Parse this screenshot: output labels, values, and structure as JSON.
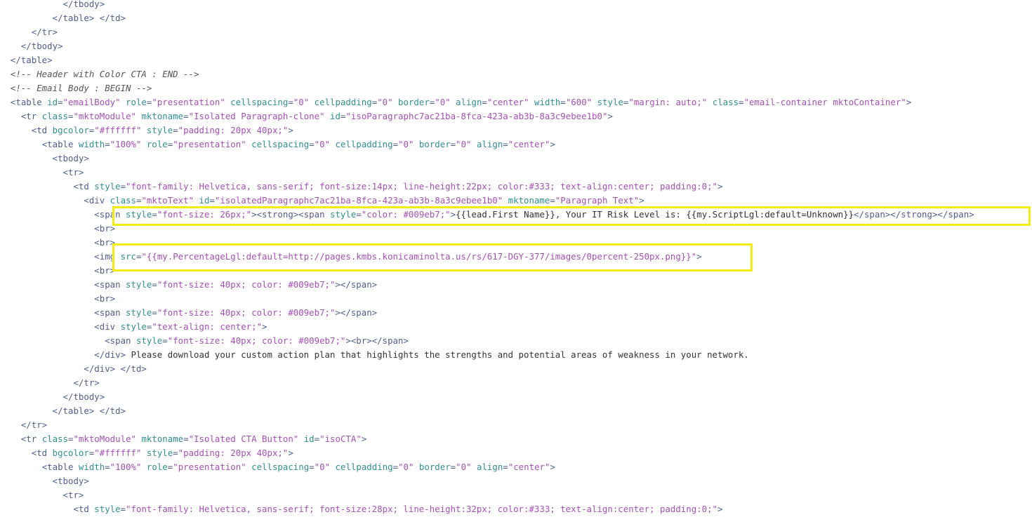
{
  "code_lines": [
    [
      {
        "t": "text",
        "v": "            "
      },
      {
        "t": "tag",
        "v": "</tbody>"
      }
    ],
    [
      {
        "t": "text",
        "v": "          "
      },
      {
        "t": "tag",
        "v": "</table>"
      },
      {
        "t": "text",
        "v": " "
      },
      {
        "t": "tag",
        "v": "</td>"
      }
    ],
    [
      {
        "t": "text",
        "v": "      "
      },
      {
        "t": "tag",
        "v": "</tr>"
      }
    ],
    [
      {
        "t": "text",
        "v": "    "
      },
      {
        "t": "tag",
        "v": "</tbody>"
      }
    ],
    [
      {
        "t": "text",
        "v": "  "
      },
      {
        "t": "tag",
        "v": "</table>"
      }
    ],
    [
      {
        "t": "text",
        "v": "  "
      },
      {
        "t": "comment",
        "v": "<!-- Header with Color CTA : END -->"
      }
    ],
    [
      {
        "t": "text",
        "v": "  "
      },
      {
        "t": "comment",
        "v": "<!-- Email Body : BEGIN -->"
      }
    ],
    [
      {
        "t": "text",
        "v": "  "
      },
      {
        "t": "tag",
        "v": "<table "
      },
      {
        "t": "attr",
        "v": "id"
      },
      {
        "t": "tag",
        "v": "="
      },
      {
        "t": "val",
        "v": "\"emailBody\""
      },
      {
        "t": "attr",
        "v": " role"
      },
      {
        "t": "tag",
        "v": "="
      },
      {
        "t": "val",
        "v": "\"presentation\""
      },
      {
        "t": "attr",
        "v": " cellspacing"
      },
      {
        "t": "tag",
        "v": "="
      },
      {
        "t": "val",
        "v": "\"0\""
      },
      {
        "t": "attr",
        "v": " cellpadding"
      },
      {
        "t": "tag",
        "v": "="
      },
      {
        "t": "val",
        "v": "\"0\""
      },
      {
        "t": "attr",
        "v": " border"
      },
      {
        "t": "tag",
        "v": "="
      },
      {
        "t": "val",
        "v": "\"0\""
      },
      {
        "t": "attr",
        "v": " align"
      },
      {
        "t": "tag",
        "v": "="
      },
      {
        "t": "val",
        "v": "\"center\""
      },
      {
        "t": "attr",
        "v": " width"
      },
      {
        "t": "tag",
        "v": "="
      },
      {
        "t": "val",
        "v": "\"600\""
      },
      {
        "t": "attr",
        "v": " style"
      },
      {
        "t": "tag",
        "v": "="
      },
      {
        "t": "val",
        "v": "\"margin: auto;\""
      },
      {
        "t": "attr",
        "v": " class"
      },
      {
        "t": "tag",
        "v": "="
      },
      {
        "t": "val",
        "v": "\"email-container mktoContainer\""
      },
      {
        "t": "tag",
        "v": ">"
      }
    ],
    [
      {
        "t": "text",
        "v": "    "
      },
      {
        "t": "tag",
        "v": "<tr "
      },
      {
        "t": "attr",
        "v": "class"
      },
      {
        "t": "tag",
        "v": "="
      },
      {
        "t": "val",
        "v": "\"mktoModule\""
      },
      {
        "t": "attr",
        "v": " mktoname"
      },
      {
        "t": "tag",
        "v": "="
      },
      {
        "t": "val",
        "v": "\"Isolated Paragraph-clone\""
      },
      {
        "t": "attr",
        "v": " id"
      },
      {
        "t": "tag",
        "v": "="
      },
      {
        "t": "val",
        "v": "\"isoParagraphc7ac21ba-8fca-423a-ab3b-8a3c9ebee1b0\""
      },
      {
        "t": "tag",
        "v": ">"
      }
    ],
    [
      {
        "t": "text",
        "v": "      "
      },
      {
        "t": "tag",
        "v": "<td "
      },
      {
        "t": "attr",
        "v": "bgcolor"
      },
      {
        "t": "tag",
        "v": "="
      },
      {
        "t": "val",
        "v": "\"#ffffff\""
      },
      {
        "t": "attr",
        "v": " style"
      },
      {
        "t": "tag",
        "v": "="
      },
      {
        "t": "val",
        "v": "\"padding: 20px 40px;\""
      },
      {
        "t": "tag",
        "v": ">"
      }
    ],
    [
      {
        "t": "text",
        "v": "        "
      },
      {
        "t": "tag",
        "v": "<table "
      },
      {
        "t": "attr",
        "v": "width"
      },
      {
        "t": "tag",
        "v": "="
      },
      {
        "t": "val",
        "v": "\"100%\""
      },
      {
        "t": "attr",
        "v": " role"
      },
      {
        "t": "tag",
        "v": "="
      },
      {
        "t": "val",
        "v": "\"presentation\""
      },
      {
        "t": "attr",
        "v": " cellspacing"
      },
      {
        "t": "tag",
        "v": "="
      },
      {
        "t": "val",
        "v": "\"0\""
      },
      {
        "t": "attr",
        "v": " cellpadding"
      },
      {
        "t": "tag",
        "v": "="
      },
      {
        "t": "val",
        "v": "\"0\""
      },
      {
        "t": "attr",
        "v": " border"
      },
      {
        "t": "tag",
        "v": "="
      },
      {
        "t": "val",
        "v": "\"0\""
      },
      {
        "t": "attr",
        "v": " align"
      },
      {
        "t": "tag",
        "v": "="
      },
      {
        "t": "val",
        "v": "\"center\""
      },
      {
        "t": "tag",
        "v": ">"
      }
    ],
    [
      {
        "t": "text",
        "v": "          "
      },
      {
        "t": "tag",
        "v": "<tbody>"
      }
    ],
    [
      {
        "t": "text",
        "v": "            "
      },
      {
        "t": "tag",
        "v": "<tr>"
      }
    ],
    [
      {
        "t": "text",
        "v": "              "
      },
      {
        "t": "tag",
        "v": "<td "
      },
      {
        "t": "attr",
        "v": "style"
      },
      {
        "t": "tag",
        "v": "="
      },
      {
        "t": "val",
        "v": "\"font-family: Helvetica, sans-serif; font-size:14px; line-height:22px; color:#333; text-align:center; padding:0;\""
      },
      {
        "t": "tag",
        "v": ">"
      }
    ],
    [
      {
        "t": "text",
        "v": "                "
      },
      {
        "t": "tag",
        "v": "<div "
      },
      {
        "t": "attr",
        "v": "class"
      },
      {
        "t": "tag",
        "v": "="
      },
      {
        "t": "val",
        "v": "\"mktoText\""
      },
      {
        "t": "attr",
        "v": " id"
      },
      {
        "t": "tag",
        "v": "="
      },
      {
        "t": "val",
        "v": "\"isolatedParagraphc7ac21ba-8fca-423a-ab3b-8a3c9ebee1b0\""
      },
      {
        "t": "attr",
        "v": " mktoname"
      },
      {
        "t": "tag",
        "v": "="
      },
      {
        "t": "val",
        "v": "\"Paragraph Text\""
      },
      {
        "t": "tag",
        "v": ">"
      }
    ],
    [
      {
        "t": "text",
        "v": "                  "
      },
      {
        "t": "tag",
        "v": "<span "
      },
      {
        "t": "attr",
        "v": "style"
      },
      {
        "t": "tag",
        "v": "="
      },
      {
        "t": "val",
        "v": "\"font-size: 26px;\""
      },
      {
        "t": "tag",
        "v": "><strong><span "
      },
      {
        "t": "attr",
        "v": "style"
      },
      {
        "t": "tag",
        "v": "="
      },
      {
        "t": "val",
        "v": "\"color: #009eb7;\""
      },
      {
        "t": "tag",
        "v": ">"
      },
      {
        "t": "text",
        "v": "{{lead.First Name}}, Your IT Risk Level is: {{my.ScriptLgl:default=Unknown}}"
      },
      {
        "t": "tag",
        "v": "</span></strong></span>"
      }
    ],
    [
      {
        "t": "text",
        "v": "                  "
      },
      {
        "t": "tag",
        "v": "<br>"
      }
    ],
    [
      {
        "t": "text",
        "v": "                  "
      },
      {
        "t": "tag",
        "v": "<br>"
      }
    ],
    [
      {
        "t": "text",
        "v": "                  "
      },
      {
        "t": "tag",
        "v": "<img "
      },
      {
        "t": "attr",
        "v": "src"
      },
      {
        "t": "tag",
        "v": "="
      },
      {
        "t": "val",
        "v": "\"{{my.PercentageLgl:default=http://pages.kmbs.konicaminolta.us/rs/617-DGY-377/images/0percent-250px.png}}\""
      },
      {
        "t": "tag",
        "v": ">"
      }
    ],
    [
      {
        "t": "text",
        "v": "                  "
      },
      {
        "t": "tag",
        "v": "<br>"
      }
    ],
    [
      {
        "t": "text",
        "v": "                  "
      },
      {
        "t": "tag",
        "v": "<span "
      },
      {
        "t": "attr",
        "v": "style"
      },
      {
        "t": "tag",
        "v": "="
      },
      {
        "t": "val",
        "v": "\"font-size: 40px; color: #009eb7;\""
      },
      {
        "t": "tag",
        "v": "></span>"
      }
    ],
    [
      {
        "t": "text",
        "v": "                  "
      },
      {
        "t": "tag",
        "v": "<br>"
      }
    ],
    [
      {
        "t": "text",
        "v": "                  "
      },
      {
        "t": "tag",
        "v": "<span "
      },
      {
        "t": "attr",
        "v": "style"
      },
      {
        "t": "tag",
        "v": "="
      },
      {
        "t": "val",
        "v": "\"font-size: 40px; color: #009eb7;\""
      },
      {
        "t": "tag",
        "v": "></span>"
      }
    ],
    [
      {
        "t": "text",
        "v": "                  "
      },
      {
        "t": "tag",
        "v": "<div "
      },
      {
        "t": "attr",
        "v": "style"
      },
      {
        "t": "tag",
        "v": "="
      },
      {
        "t": "val",
        "v": "\"text-align: center;\""
      },
      {
        "t": "tag",
        "v": ">"
      }
    ],
    [
      {
        "t": "text",
        "v": "                    "
      },
      {
        "t": "tag",
        "v": "<span "
      },
      {
        "t": "attr",
        "v": "style"
      },
      {
        "t": "tag",
        "v": "="
      },
      {
        "t": "val",
        "v": "\"font-size: 40px; color: #009eb7;\""
      },
      {
        "t": "tag",
        "v": "><br></span>"
      }
    ],
    [
      {
        "t": "text",
        "v": "                  "
      },
      {
        "t": "tag",
        "v": "</div>"
      },
      {
        "t": "text",
        "v": " Please download your custom action plan that highlights the strengths and potential areas of weakness in your network."
      }
    ],
    [
      {
        "t": "text",
        "v": "                "
      },
      {
        "t": "tag",
        "v": "</div>"
      },
      {
        "t": "text",
        "v": " "
      },
      {
        "t": "tag",
        "v": "</td>"
      }
    ],
    [
      {
        "t": "text",
        "v": "              "
      },
      {
        "t": "tag",
        "v": "</tr>"
      }
    ],
    [
      {
        "t": "text",
        "v": "            "
      },
      {
        "t": "tag",
        "v": "</tbody>"
      }
    ],
    [
      {
        "t": "text",
        "v": "          "
      },
      {
        "t": "tag",
        "v": "</table>"
      },
      {
        "t": "text",
        "v": " "
      },
      {
        "t": "tag",
        "v": "</td>"
      }
    ],
    [
      {
        "t": "text",
        "v": "    "
      },
      {
        "t": "tag",
        "v": "</tr>"
      }
    ],
    [
      {
        "t": "text",
        "v": "    "
      },
      {
        "t": "tag",
        "v": "<tr "
      },
      {
        "t": "attr",
        "v": "class"
      },
      {
        "t": "tag",
        "v": "="
      },
      {
        "t": "val",
        "v": "\"mktoModule\""
      },
      {
        "t": "attr",
        "v": " mktoname"
      },
      {
        "t": "tag",
        "v": "="
      },
      {
        "t": "val",
        "v": "\"Isolated CTA Button\""
      },
      {
        "t": "attr",
        "v": " id"
      },
      {
        "t": "tag",
        "v": "="
      },
      {
        "t": "val",
        "v": "\"isoCTA\""
      },
      {
        "t": "tag",
        "v": ">"
      }
    ],
    [
      {
        "t": "text",
        "v": "      "
      },
      {
        "t": "tag",
        "v": "<td "
      },
      {
        "t": "attr",
        "v": "bgcolor"
      },
      {
        "t": "tag",
        "v": "="
      },
      {
        "t": "val",
        "v": "\"#ffffff\""
      },
      {
        "t": "attr",
        "v": " style"
      },
      {
        "t": "tag",
        "v": "="
      },
      {
        "t": "val",
        "v": "\"padding: 20px 40px;\""
      },
      {
        "t": "tag",
        "v": ">"
      }
    ],
    [
      {
        "t": "text",
        "v": "        "
      },
      {
        "t": "tag",
        "v": "<table "
      },
      {
        "t": "attr",
        "v": "width"
      },
      {
        "t": "tag",
        "v": "="
      },
      {
        "t": "val",
        "v": "\"100%\""
      },
      {
        "t": "attr",
        "v": " role"
      },
      {
        "t": "tag",
        "v": "="
      },
      {
        "t": "val",
        "v": "\"presentation\""
      },
      {
        "t": "attr",
        "v": " cellspacing"
      },
      {
        "t": "tag",
        "v": "="
      },
      {
        "t": "val",
        "v": "\"0\""
      },
      {
        "t": "attr",
        "v": " cellpadding"
      },
      {
        "t": "tag",
        "v": "="
      },
      {
        "t": "val",
        "v": "\"0\""
      },
      {
        "t": "attr",
        "v": " border"
      },
      {
        "t": "tag",
        "v": "="
      },
      {
        "t": "val",
        "v": "\"0\""
      },
      {
        "t": "attr",
        "v": " align"
      },
      {
        "t": "tag",
        "v": "="
      },
      {
        "t": "val",
        "v": "\"center\""
      },
      {
        "t": "tag",
        "v": ">"
      }
    ],
    [
      {
        "t": "text",
        "v": "          "
      },
      {
        "t": "tag",
        "v": "<tbody>"
      }
    ],
    [
      {
        "t": "text",
        "v": "            "
      },
      {
        "t": "tag",
        "v": "<tr>"
      }
    ],
    [
      {
        "t": "text",
        "v": "              "
      },
      {
        "t": "tag",
        "v": "<td "
      },
      {
        "t": "attr",
        "v": "style"
      },
      {
        "t": "tag",
        "v": "="
      },
      {
        "t": "val",
        "v": "\"font-family: Helvetica, sans-serif; font-size:28px; line-height:32px; color:#333; text-align:center; padding:0;\""
      },
      {
        "t": "tag",
        "v": ">"
      }
    ]
  ],
  "highlight_color": "#f2ec13",
  "token_colors": {
    "tag": "#4f5d8c",
    "attr": "#2f8f92",
    "val": "#a54fb5",
    "comment": "#555555",
    "text": "#333333"
  }
}
